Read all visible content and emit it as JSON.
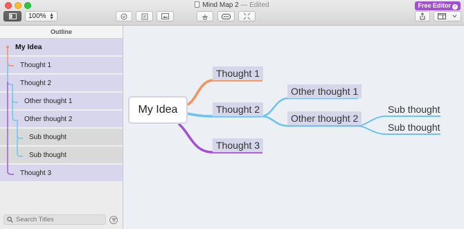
{
  "window": {
    "title": "Mind Map 2",
    "edited_label": "— Edited",
    "free_editor_label": "Free Editor"
  },
  "toolbar": {
    "zoom_value": "100%",
    "icons": [
      "sidebar-toggle-icon",
      "checkmark-circle-icon",
      "note-icon",
      "image-icon",
      "connect-icon",
      "outline-node-icon",
      "fit-icon",
      "share-icon",
      "layout-icon",
      "chevron-down-icon"
    ]
  },
  "sidebar": {
    "header": "Outline",
    "items": [
      {
        "label": "My Idea",
        "level": 0
      },
      {
        "label": "Thought 1",
        "level": 1
      },
      {
        "label": "Thought 2",
        "level": 1
      },
      {
        "label": "Other thought 1",
        "level": 2
      },
      {
        "label": "Other thought 2",
        "level": 2
      },
      {
        "label": "Sub thought",
        "level": 3
      },
      {
        "label": "Sub thought",
        "level": 3
      },
      {
        "label": "Thought 3",
        "level": 1
      }
    ],
    "search_placeholder": "Search Titles"
  },
  "mindmap": {
    "root": "My Idea",
    "thought1": "Thought 1",
    "thought2": "Thought 2",
    "thought3": "Thought 3",
    "other1": "Other thought 1",
    "other2": "Other thought 2",
    "sub1": "Sub thought",
    "sub2": "Sub thought"
  },
  "colors": {
    "branch_orange": "#f4925a",
    "branch_blue": "#6cc3f0",
    "branch_purple": "#a34fd6",
    "node_highlight": "#d5d6ea",
    "accent": "#a34fd6"
  }
}
